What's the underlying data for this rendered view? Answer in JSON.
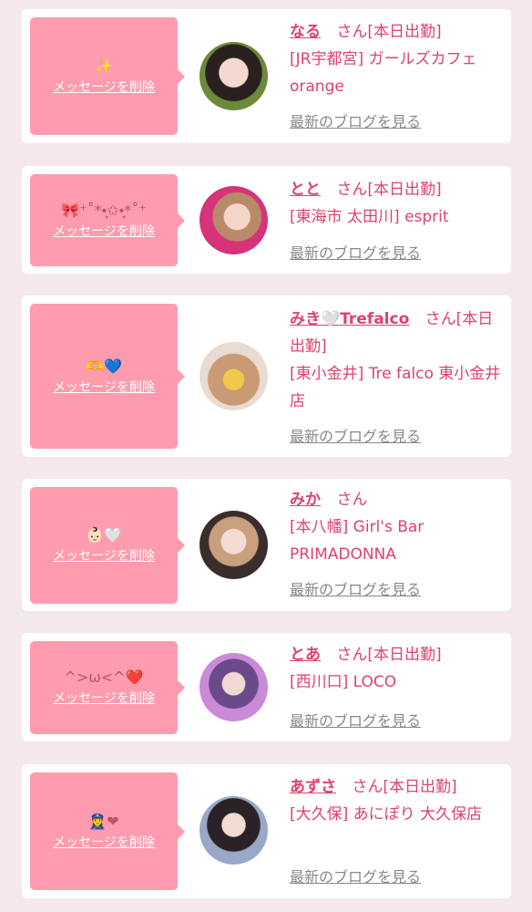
{
  "delete_label": "メッセージを削除",
  "san_label": "さん",
  "blog_label": "最新のブログを見る",
  "colors": {
    "accent": "#e0416b",
    "bubble": "#fe9bae",
    "background": "#f5e8ec"
  },
  "cards": [
    {
      "emoji": "✨",
      "name": "なる",
      "status": "[本日出勤]",
      "shop": "[JR宇都宮] ガールズカフェ orange"
    },
    {
      "emoji": "🎀⁺˚*•̩̩͙✩•̩̩͙*˚⁺",
      "name": "とと",
      "status": "[本日出勤]",
      "shop": "[東海市 太田川] esprit"
    },
    {
      "emoji": "🫶💙",
      "name": "みき🤍Trefalco",
      "status": "[本日出勤]",
      "shop": "[東小金井] Tre falco 東小金井店"
    },
    {
      "emoji": "👶🏻🤍",
      "name": "みか",
      "status": "",
      "shop": "[本八幡] Girl's Bar PRIMADONNA"
    },
    {
      "emoji": "^>ω<^❤️",
      "name": "とあ",
      "status": "[本日出勤]",
      "shop": "[西川口] LOCO"
    },
    {
      "emoji": "👮‍♀️❤",
      "name": "あずさ",
      "status": "[本日出勤]",
      "shop": "[大久保] あにぽり 大久保店"
    }
  ]
}
